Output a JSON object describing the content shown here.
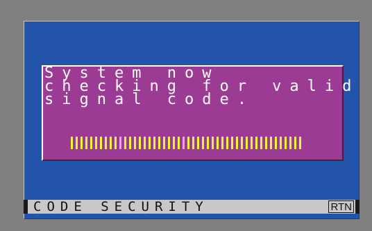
{
  "dialog": {
    "lines": [
      "System now",
      "checking for valid",
      "signal code."
    ]
  },
  "progress": {
    "bar_count": 48,
    "highlight_after": [
      10,
      23
    ],
    "color": "#f4f43c"
  },
  "statusbar": {
    "label": "CODE SECURITY",
    "return_button": "RTN"
  },
  "colors": {
    "outer_bezel": "#808080",
    "screen_bg": "#2255a9",
    "dialog_bg": "#9b3b94",
    "text": "#ffffff",
    "statusbar_bg": "#c8c8c8"
  }
}
